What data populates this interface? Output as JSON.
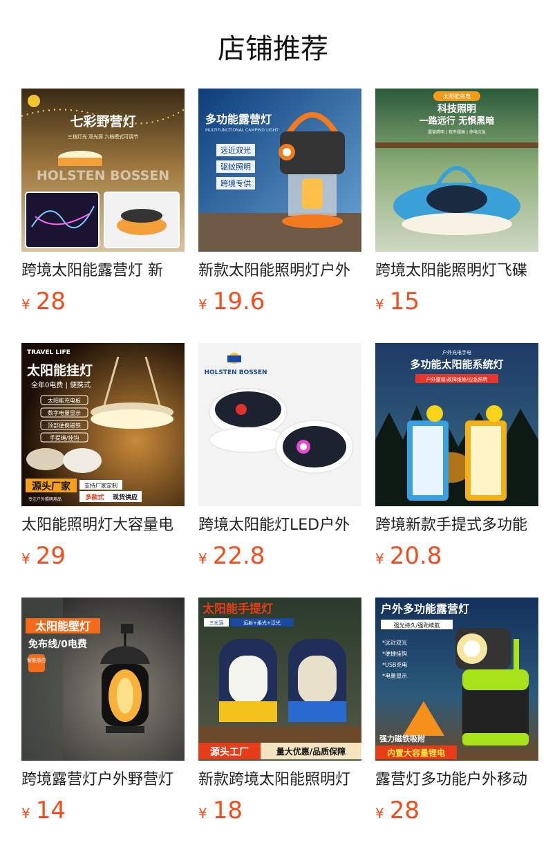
{
  "header": {
    "title": "店铺推荐"
  },
  "currency": "¥",
  "products": [
    {
      "name": "跨境太阳能露营灯 新",
      "price": "28",
      "img_text": [
        "七彩野营灯",
        "三挡灯光 双光源 六档模式可调节",
        "HOLSTEN BOSSEN"
      ]
    },
    {
      "name": "新款太阳能照明灯户外",
      "price": "19.6",
      "img_text": [
        "多功能露营灯",
        "MULTIFUNCTIONAL CAMPING LIGHT",
        "远近双光",
        "驱蚊照明",
        "跨境专供"
      ]
    },
    {
      "name": "跨境太阳能照明灯飞碟",
      "price": "15",
      "img_text": [
        "太阳能充电",
        "科技照明",
        "一路远行 无惧黑暗",
        "露营照明 | 夜市摆摊 | 停电应急"
      ]
    },
    {
      "name": "太阳能照明灯大容量电",
      "price": "29",
      "img_text": [
        "TRAVEL LIFE",
        "太阳能挂灯",
        "全年0电费 | 便携式",
        "太阳能充电板",
        "数字电量显示",
        "顶部便携磁铁",
        "手提绳/挂钩",
        "源头厂家",
        "支持厂家定制",
        "专注户外照明用品",
        "多款式",
        "现货供应"
      ]
    },
    {
      "name": "跨境太阳能灯LED户外",
      "price": "22.8",
      "img_text": [
        "HOLSTEN BOSSEN"
      ]
    },
    {
      "name": "跨境新款手提式多功能",
      "price": "20.8",
      "img_text": [
        "户外充电手电",
        "多功能太阳能系统灯",
        "户外露营/故障维修/应急照明"
      ]
    },
    {
      "name": "跨境露营灯户外野营灯",
      "price": "14",
      "img_text": [
        "太阳能壁灯",
        "免布线/0电费",
        "智能感应"
      ]
    },
    {
      "name": "新款跨境太阳能照明灯",
      "price": "18",
      "img_text": [
        "太阳能手提灯",
        "三光源",
        "远射+柔光+泛光",
        "源头工厂",
        "量大优惠/品质保障"
      ]
    },
    {
      "name": "露营灯多功能户外移动",
      "price": "28",
      "img_text": [
        "户外多功能露营灯",
        "强光持久/强劲续航",
        "*远近双光",
        "*便捷挂钩",
        "*USB充电",
        "*电量显示",
        "强力磁铁吸附",
        "内置大容量锂电"
      ]
    }
  ]
}
